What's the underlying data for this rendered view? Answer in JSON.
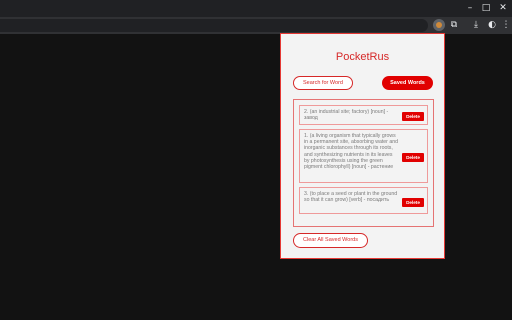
{
  "browser": {
    "window_controls": {
      "minimize": "–",
      "maximize": "□",
      "close": "✕"
    },
    "toolbar_icons": [
      "extensions-icon",
      "download-icon",
      "profile-icon",
      "menu-icon"
    ]
  },
  "popup": {
    "title": "PocketRus",
    "tabs": {
      "search_label": "Search for Word",
      "saved_label": "Saved Words"
    },
    "saved_words": [
      {
        "text": "2. (an industrial site; factory) [noun] - завод",
        "delete_label": "Delete"
      },
      {
        "text": "1. (a living organism that typically grows in a permanent site, absorbing water and inorganic substances through its roots, and synthesizing nutrients in its leaves by photosynthesis using the green pigment chlorophyll) [noun] - растение",
        "delete_label": "Delete"
      },
      {
        "text": "3. (to place a seed or plant in the ground so that it can grow) [verb] - посадить",
        "delete_label": "Delete"
      }
    ],
    "clear_label": "Clear All Saved Words",
    "accent_color": "#e10000"
  }
}
